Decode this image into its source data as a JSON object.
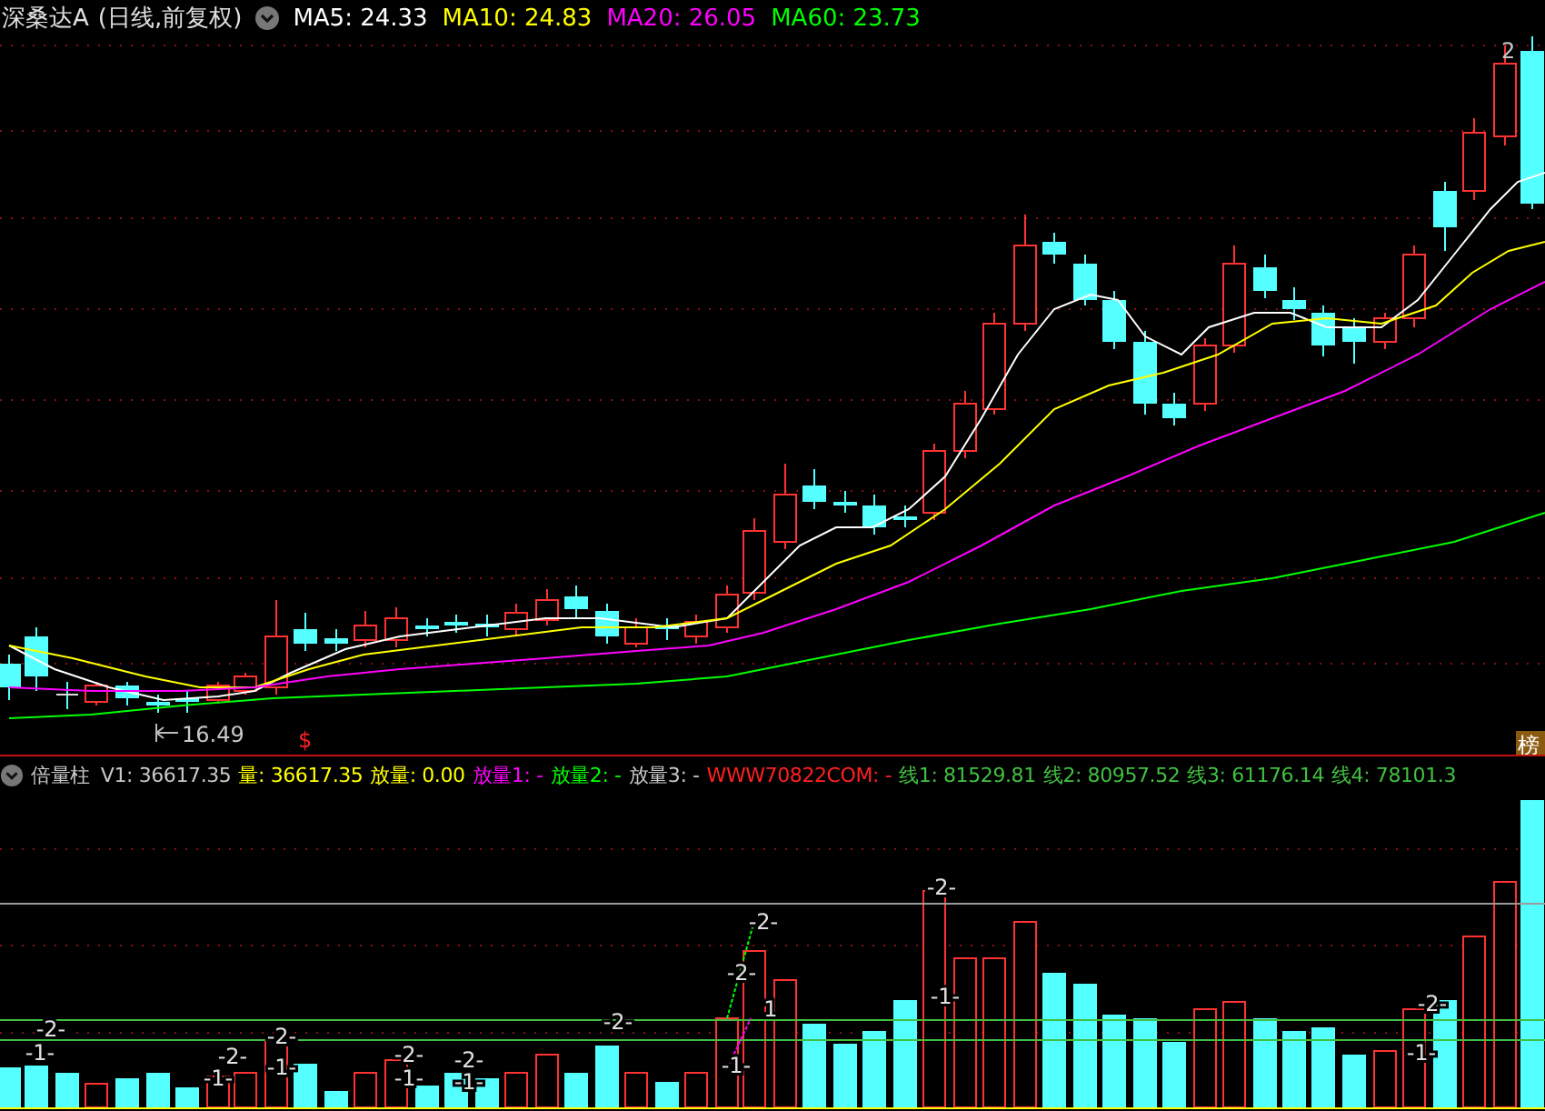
{
  "chart_header": {
    "title": "深桑达A",
    "period": "(日线,前复权)",
    "moving_averages": [
      {
        "label": "MA5: 24.33",
        "color": "#ffffff"
      },
      {
        "label": "MA10: 24.83",
        "color": "#ffff00"
      },
      {
        "label": "MA20: 26.05",
        "color": "#ff00ff"
      },
      {
        "label": "MA60: 23.73",
        "color": "#00ff00"
      }
    ]
  },
  "main_chart": {
    "low_marker": "16.49",
    "high_marker": "2",
    "signal_marker": "$",
    "badge": "榜"
  },
  "indicator_header": {
    "name": "倍量柱",
    "items": [
      {
        "text": "V1: 36617.35",
        "color": "#c8c8c8"
      },
      {
        "text": "量: 36617.35",
        "color": "#ffff00"
      },
      {
        "text": "放量: 0.00",
        "color": "#ffff00"
      },
      {
        "text": "放量1: -",
        "color": "#ff00ff"
      },
      {
        "text": "放量2: -",
        "color": "#00ff00"
      },
      {
        "text": "放量3: -",
        "color": "#c8c8c8"
      },
      {
        "text": "WWW70822COM: -",
        "color": "#ff2020"
      },
      {
        "text": "线1: 81529.81",
        "color": "#40c040"
      },
      {
        "text": "线2: 80957.52",
        "color": "#40c040"
      },
      {
        "text": "线3: 61176.14",
        "color": "#40c040"
      },
      {
        "text": "线4: 78101.3",
        "color": "#40c040"
      }
    ]
  },
  "volume_labels": [
    "-2-",
    "-1-",
    "-2-",
    "-1-",
    "-2-",
    "-1-",
    "-2-",
    "-1-",
    "-2-",
    "-1-",
    "-2-",
    "-2-",
    "-2-",
    "1",
    "-1-",
    "-2-",
    "-1-",
    "-2-",
    "-1-"
  ]
}
